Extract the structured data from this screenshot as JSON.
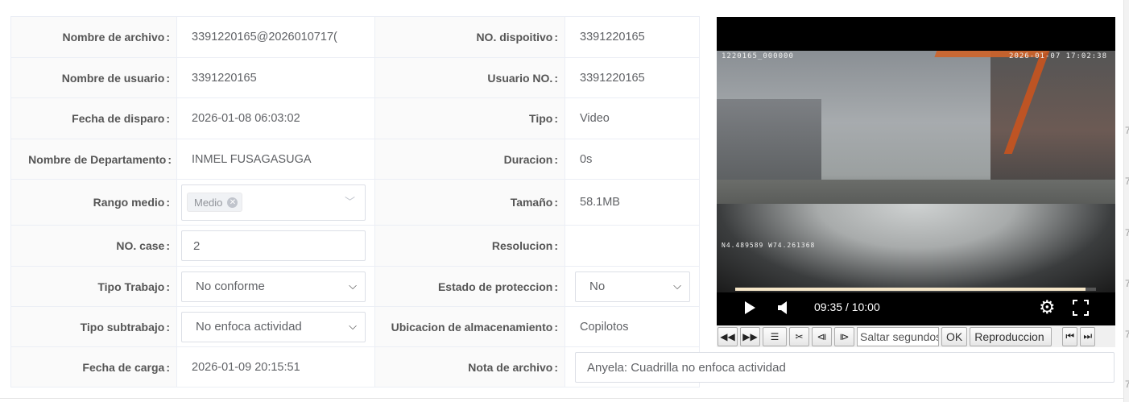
{
  "fields": {
    "file_name": {
      "label": "Nombre de archivo",
      "value": "3391220165@2026010717("
    },
    "device_no": {
      "label": "NO. dispoitivo",
      "value": "3391220165"
    },
    "user_name": {
      "label": "Nombre de usuario",
      "value": "3391220165"
    },
    "user_no": {
      "label": "Usuario NO.",
      "value": "3391220165"
    },
    "trigger_date": {
      "label": "Fecha de disparo",
      "value": "2026-01-08 06:03:02"
    },
    "type": {
      "label": "Tipo",
      "value": "Video"
    },
    "department": {
      "label": "Nombre de Departamento",
      "value": "INMEL FUSAGASUGA"
    },
    "duration": {
      "label": "Duracion",
      "value": "0s"
    },
    "medium_range": {
      "label": "Rango medio",
      "tag": "Medio"
    },
    "size": {
      "label": "Tamaño",
      "value": "58.1MB"
    },
    "case_no": {
      "label": "NO. case",
      "value": "2"
    },
    "resolution": {
      "label": "Resolucion",
      "value": ""
    },
    "work_type": {
      "label": "Tipo Trabajo",
      "value": "No conforme"
    },
    "protection_state": {
      "label": "Estado de proteccion",
      "value": "No"
    },
    "work_subtype": {
      "label": "Tipo subtrabajo",
      "value": "No enfoca actividad"
    },
    "storage_location": {
      "label": "Ubicacion de almacenamiento",
      "value": "Copilotos"
    },
    "upload_date": {
      "label": "Fecha de carga",
      "value": "2026-01-09 20:15:51"
    },
    "file_note": {
      "label": "Nota de archivo",
      "value": "Anyela: Cuadrilla no enfoca actividad"
    }
  },
  "colon": ":",
  "video": {
    "osd_top_left": "1220165_000000",
    "osd_top_right": "2026-01-07 17:02:38",
    "osd_bottom_left": "N4.489589 W74.261368",
    "time_display": "09:35 / 10:00",
    "progress": 0.97
  },
  "toolbar": {
    "seek_placeholder": "Saltar segundos",
    "ok_label": "OK",
    "playback_label": "Reproduccion"
  },
  "right_edge_marks": [
    "7",
    "7",
    "7",
    "7",
    "7",
    "7",
    "7"
  ],
  "icons": [
    "chevron-down-icon",
    "tag-close-icon",
    "play-icon",
    "volume-icon",
    "settings-icon",
    "fullscreen-icon",
    "rewind-icon",
    "fast-forward-icon",
    "list-icon",
    "scissors-icon",
    "frame-back-icon",
    "frame-forward-icon",
    "skip-start-icon",
    "skip-end-icon"
  ],
  "colors": {
    "label_bg": "#fafafa",
    "border": "#ebeef5",
    "text": "#606266",
    "video_bg": "#000000",
    "progress": "#f5e6c8"
  }
}
